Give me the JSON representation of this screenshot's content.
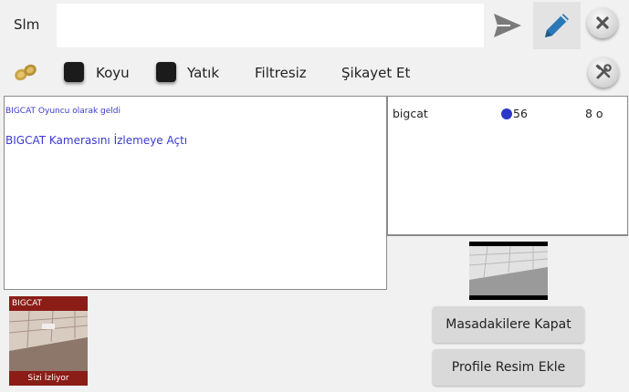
{
  "composer": {
    "label": "Slm",
    "value": "",
    "placeholder": ""
  },
  "options": {
    "koyu_label": "Koyu",
    "yatik_label": "Yatık",
    "filtresiz_label": "Filtresiz",
    "sikayet_label": "Şikayet Et"
  },
  "chat": {
    "messages": [
      "BIGCAT Oyuncu olarak geldi",
      "BIGCAT Kamerasını İzlemeye Açtı"
    ]
  },
  "users": [
    {
      "name": "bigcat",
      "points": "56",
      "col3": "8 o"
    }
  ],
  "buttons": {
    "kapat": "Masadakilere Kapat",
    "resim": "Profile Resim Ekle"
  },
  "watcher": {
    "name": "BIGCAT",
    "status": "Sizi İzliyor"
  },
  "colors": {
    "chat_text": "#3a3ad0",
    "user_dot": "#2a36c8",
    "watcher_bar": "#8b1c16",
    "pen_icon": "#2a78b8"
  }
}
